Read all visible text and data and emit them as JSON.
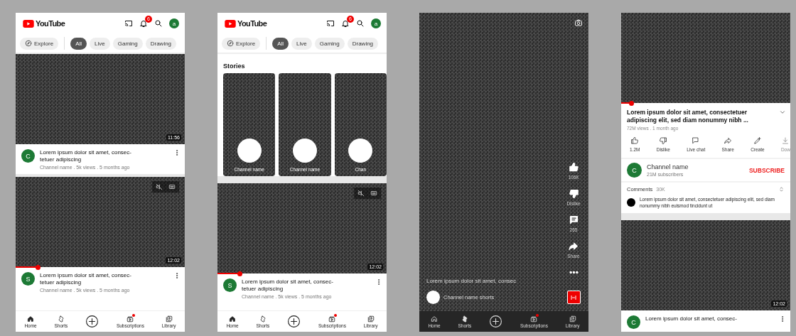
{
  "screens": [
    {
      "kind": "home",
      "header": {
        "logo": "YouTube",
        "notifications": "6",
        "avatar": "a"
      },
      "chips": [
        {
          "kind": "explore",
          "label": "Explore",
          "selected": false
        },
        {
          "kind": "filter",
          "label": "All",
          "selected": true
        },
        {
          "kind": "filter",
          "label": "Live",
          "selected": false
        },
        {
          "kind": "filter",
          "label": "Gaming",
          "selected": false
        },
        {
          "kind": "filter",
          "label": "Drawing",
          "selected": false
        }
      ],
      "feed": [
        {
          "duration": "11:56",
          "muted": false,
          "avatar": "C",
          "title": "Lorem ipsum dolor sit amet, consec-\ntetuer adipiscing",
          "meta": "Channel name . 5k views . 5 months ago"
        },
        {
          "duration": "12:02",
          "muted": true,
          "level": 0.13,
          "avatar": "S",
          "title": "Lorem ipsum dolor sit amet, consec-\ntetuer adipiscing",
          "meta": "Channel name . 5k views . 5 months ago"
        }
      ],
      "nav": [
        {
          "kind": "home",
          "label": "Home",
          "selected": true,
          "badge": false
        },
        {
          "kind": "shorts",
          "label": "Shorts",
          "selected": false,
          "badge": false
        },
        {
          "kind": "create",
          "selected": false,
          "badge": false
        },
        {
          "kind": "subscriptions",
          "label": "Subscriptions",
          "selected": false,
          "badge": true
        },
        {
          "kind": "library",
          "label": "Library",
          "selected": false,
          "badge": false
        }
      ]
    },
    {
      "kind": "home",
      "header": {
        "logo": "YouTube",
        "notifications": "6",
        "avatar": "a"
      },
      "chips": [
        {
          "kind": "explore",
          "label": "Explore",
          "selected": false
        },
        {
          "kind": "filter",
          "label": "All",
          "selected": true
        },
        {
          "kind": "filter",
          "label": "Live",
          "selected": false
        },
        {
          "kind": "filter",
          "label": "Gaming",
          "selected": false
        },
        {
          "kind": "filter",
          "label": "Drawing",
          "selected": false
        }
      ],
      "stories": {
        "title": "Stories",
        "items": [
          {
            "name": "Channel name"
          },
          {
            "name": "Channel name"
          },
          {
            "name": "Chan"
          }
        ]
      },
      "feed": [
        {
          "duration": "12:02",
          "muted": true,
          "level": 0.13,
          "avatar": "S",
          "title": "Lorem ipsum dolor sit amet, consec-\ntetuer adipiscing",
          "meta": "Channel name . 5k views . 5 months ago"
        }
      ],
      "nav": [
        {
          "kind": "home",
          "label": "Home",
          "selected": true,
          "badge": false
        },
        {
          "kind": "shorts",
          "label": "Shorts",
          "selected": false,
          "badge": false
        },
        {
          "kind": "create",
          "selected": false,
          "badge": false
        },
        {
          "kind": "subscriptions",
          "label": "Subscriptions",
          "selected": false,
          "badge": true
        },
        {
          "kind": "library",
          "label": "Library",
          "selected": false,
          "badge": false
        }
      ]
    },
    {
      "kind": "shorts",
      "title": "Lorem ipsum dolor sit amet, consec",
      "channel": "Channel name shorts",
      "actions": [
        {
          "kind": "like",
          "label": "106K"
        },
        {
          "kind": "dislike",
          "label": "Dislike"
        },
        {
          "kind": "comment",
          "label": "265"
        },
        {
          "kind": "share",
          "label": "Share"
        },
        {
          "kind": "more"
        }
      ],
      "nav": [
        {
          "kind": "home",
          "label": "Home",
          "selected": false,
          "badge": false
        },
        {
          "kind": "shorts",
          "label": "Shorts",
          "selected": true,
          "badge": false
        },
        {
          "kind": "create",
          "selected": false,
          "badge": false
        },
        {
          "kind": "subscriptions",
          "label": "Subscriptions",
          "selected": false,
          "badge": true
        },
        {
          "kind": "library",
          "label": "Library",
          "selected": false,
          "badge": false
        }
      ]
    },
    {
      "kind": "watch",
      "video": {
        "level": 0.06
      },
      "title": "Lorem ipsum dolor sit amet, consectetuer adipiscing elit, sed diam nonummy nibh ...",
      "meta": "72M views . 1 month ago",
      "actions": [
        {
          "kind": "like",
          "label": "1.2M",
          "disabled": false
        },
        {
          "kind": "dislike",
          "label": "Dislike",
          "disabled": false
        },
        {
          "kind": "livechat",
          "label": "Live chat",
          "disabled": false
        },
        {
          "kind": "share",
          "label": "Share",
          "disabled": false
        },
        {
          "kind": "create",
          "label": "Create",
          "disabled": false
        },
        {
          "kind": "download",
          "label": "Dow",
          "disabled": true
        }
      ],
      "channel": {
        "avatar": "C",
        "name": "Channel name",
        "subscribers": "21M subscribers",
        "subscribe": "SUBSCRIBE"
      },
      "comments": {
        "label": "Comments",
        "count": "30K",
        "text": "Lorem ipsum dolor sit amet, consectetuer adipiscing elit, sed diam nonummy nibh euismod tincidunt ut"
      },
      "feed": [
        {
          "duration": "12:02",
          "muted": false,
          "avatar": "C",
          "title": "Lorem ipsum dolor sit amet, consec-"
        }
      ]
    }
  ]
}
